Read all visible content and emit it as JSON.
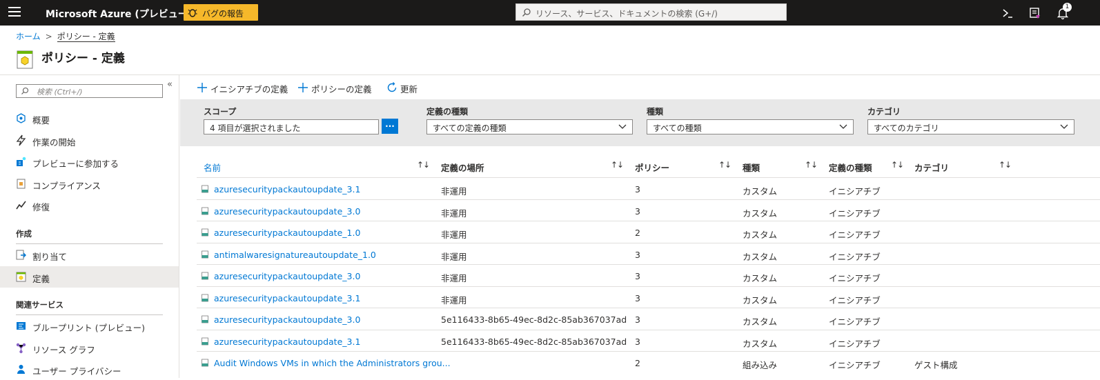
{
  "topbar": {
    "title": "Microsoft Azure (プレビュー)",
    "bug_label": "バグの報告",
    "search_placeholder": "リソース、サービス、ドキュメントの検索 (G+/)",
    "notification_count": "1"
  },
  "breadcrumb": {
    "home": "ホーム",
    "sep": ">",
    "current": "ポリシー - 定義"
  },
  "page": {
    "title": "ポリシー - 定義"
  },
  "sidebar": {
    "search_placeholder": "検索 (Ctrl+/)",
    "collapse": "«",
    "items": [
      {
        "label": "概要",
        "icon": "overview-icon"
      },
      {
        "label": "作業の開始",
        "icon": "lightning-icon"
      },
      {
        "label": "プレビューに参加する",
        "icon": "preview-icon"
      },
      {
        "label": "コンプライアンス",
        "icon": "compliance-icon"
      },
      {
        "label": "修復",
        "icon": "remediation-icon"
      }
    ],
    "section_authoring": "作成",
    "authoring_items": [
      {
        "label": "割り当て",
        "icon": "assignment-icon"
      },
      {
        "label": "定義",
        "icon": "definition-icon",
        "selected": true
      }
    ],
    "section_related": "関連サービス",
    "related_items": [
      {
        "label": "ブループリント (プレビュー)",
        "icon": "blueprint-icon"
      },
      {
        "label": "リソース グラフ",
        "icon": "resource-graph-icon"
      },
      {
        "label": "ユーザー プライバシー",
        "icon": "user-privacy-icon"
      }
    ]
  },
  "toolbar": {
    "initiative_def": "イニシアチブの定義",
    "policy_def": "ポリシーの定義",
    "refresh": "更新"
  },
  "filters": {
    "scope_label": "スコープ",
    "scope_value": "4 項目が選択されました",
    "scope_button": "...",
    "deftype_label": "定義の種類",
    "deftype_value": "すべての定義の種類",
    "type_label": "種類",
    "type_value": "すべての種類",
    "category_label": "カテゴリ",
    "category_value": "すべてのカテゴリ"
  },
  "table": {
    "columns": [
      "名前",
      "定義の場所",
      "ポリシー",
      "種類",
      "定義の種類",
      "カテゴリ"
    ],
    "sort_glyph": "↑↓",
    "rows": [
      {
        "name": "azuresecuritypackautoupdate_3.1",
        "location": "非運用",
        "policies": "3",
        "type": "カスタム",
        "deftype": "イニシアチブ",
        "category": ""
      },
      {
        "name": "azuresecuritypackautoupdate_3.0",
        "location": "非運用",
        "policies": "3",
        "type": "カスタム",
        "deftype": "イニシアチブ",
        "category": ""
      },
      {
        "name": "azuresecuritypackautoupdate_1.0",
        "location": "非運用",
        "policies": "2",
        "type": "カスタム",
        "deftype": "イニシアチブ",
        "category": ""
      },
      {
        "name": "antimalwaresignatureautoupdate_1.0",
        "location": "非運用",
        "policies": "3",
        "type": "カスタム",
        "deftype": "イニシアチブ",
        "category": ""
      },
      {
        "name": "azuresecuritypackautoupdate_3.0",
        "location": "非運用",
        "policies": "3",
        "type": "カスタム",
        "deftype": "イニシアチブ",
        "category": ""
      },
      {
        "name": "azuresecuritypackautoupdate_3.1",
        "location": "非運用",
        "policies": "3",
        "type": "カスタム",
        "deftype": "イニシアチブ",
        "category": ""
      },
      {
        "name": "azuresecuritypackautoupdate_3.0",
        "location": "5e116433-8b65-49ec-8d2c-85ab367037ad",
        "policies": "3",
        "type": "カスタム",
        "deftype": "イニシアチブ",
        "category": ""
      },
      {
        "name": "azuresecuritypackautoupdate_3.1",
        "location": "5e116433-8b65-49ec-8d2c-85ab367037ad",
        "policies": "3",
        "type": "カスタム",
        "deftype": "イニシアチブ",
        "category": ""
      },
      {
        "name": "Audit Windows VMs in which the Administrators grou...",
        "location": "",
        "policies": "2",
        "type": "組み込み",
        "deftype": "イニシアチブ",
        "category": "ゲスト構成"
      }
    ]
  },
  "colors": {
    "accent": "#0078d4",
    "topbar": "#1b1a19",
    "bug": "#f6b82a",
    "filter_bg": "#e8e8e8",
    "selected": "#edebe9"
  }
}
